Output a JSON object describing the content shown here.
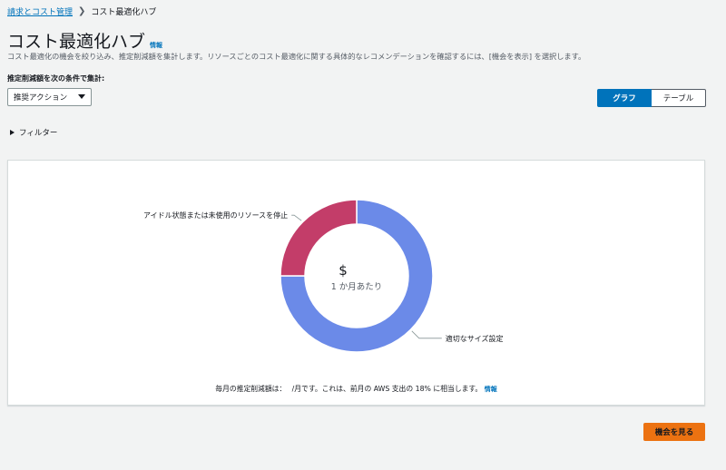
{
  "breadcrumb": {
    "parent": "請求とコスト管理",
    "current": "コスト最適化ハブ"
  },
  "header": {
    "title": "コスト最適化ハブ",
    "info": "情報"
  },
  "description": "コスト最適化の機会を絞り込み、推定削減額を集計します。リソースごとのコスト最適化に関する具体的なレコメンデーションを確認するには、[機会を表示] を選択します。",
  "aggregate": {
    "label": "推定削減額を次の条件で集計:",
    "selected": "推奨アクション"
  },
  "view_toggle": {
    "graph": "グラフ",
    "table": "テーブル",
    "active": "graph"
  },
  "filter": {
    "label": "フィルター"
  },
  "chart_data": {
    "type": "pie",
    "donut": true,
    "center_value": "$",
    "center_unit": "1 か月あたり",
    "slices": [
      {
        "label": "適切なサイズ設定",
        "color": "#6b8ae8"
      },
      {
        "label": "アイドル状態または未使用のリソースを停止",
        "color": "#c33d69"
      }
    ],
    "values": [
      0.75,
      0.25
    ]
  },
  "summary": {
    "text": "毎月の推定削減額は：　 /月です。これは、前月の AWS 支出の 18% に相当します。",
    "info": "情報"
  },
  "actions": {
    "view_opportunities": "機会を見る"
  }
}
